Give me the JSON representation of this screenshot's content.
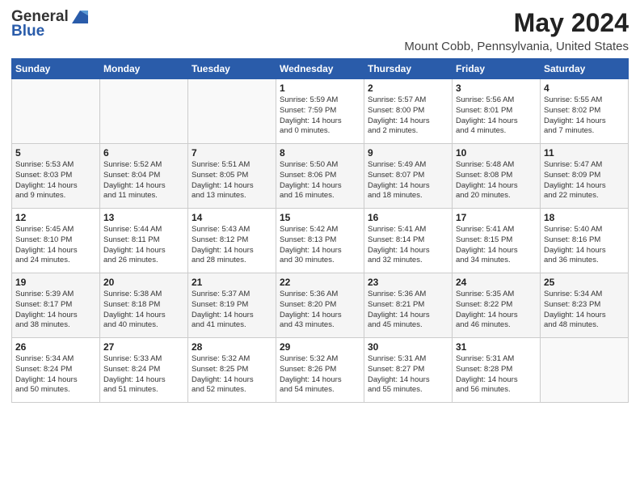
{
  "logo": {
    "general": "General",
    "blue": "Blue"
  },
  "title": "May 2024",
  "subtitle": "Mount Cobb, Pennsylvania, United States",
  "headers": [
    "Sunday",
    "Monday",
    "Tuesday",
    "Wednesday",
    "Thursday",
    "Friday",
    "Saturday"
  ],
  "weeks": [
    [
      {
        "day": "",
        "lines": []
      },
      {
        "day": "",
        "lines": []
      },
      {
        "day": "",
        "lines": []
      },
      {
        "day": "1",
        "lines": [
          "Sunrise: 5:59 AM",
          "Sunset: 7:59 PM",
          "Daylight: 14 hours",
          "and 0 minutes."
        ]
      },
      {
        "day": "2",
        "lines": [
          "Sunrise: 5:57 AM",
          "Sunset: 8:00 PM",
          "Daylight: 14 hours",
          "and 2 minutes."
        ]
      },
      {
        "day": "3",
        "lines": [
          "Sunrise: 5:56 AM",
          "Sunset: 8:01 PM",
          "Daylight: 14 hours",
          "and 4 minutes."
        ]
      },
      {
        "day": "4",
        "lines": [
          "Sunrise: 5:55 AM",
          "Sunset: 8:02 PM",
          "Daylight: 14 hours",
          "and 7 minutes."
        ]
      }
    ],
    [
      {
        "day": "5",
        "lines": [
          "Sunrise: 5:53 AM",
          "Sunset: 8:03 PM",
          "Daylight: 14 hours",
          "and 9 minutes."
        ]
      },
      {
        "day": "6",
        "lines": [
          "Sunrise: 5:52 AM",
          "Sunset: 8:04 PM",
          "Daylight: 14 hours",
          "and 11 minutes."
        ]
      },
      {
        "day": "7",
        "lines": [
          "Sunrise: 5:51 AM",
          "Sunset: 8:05 PM",
          "Daylight: 14 hours",
          "and 13 minutes."
        ]
      },
      {
        "day": "8",
        "lines": [
          "Sunrise: 5:50 AM",
          "Sunset: 8:06 PM",
          "Daylight: 14 hours",
          "and 16 minutes."
        ]
      },
      {
        "day": "9",
        "lines": [
          "Sunrise: 5:49 AM",
          "Sunset: 8:07 PM",
          "Daylight: 14 hours",
          "and 18 minutes."
        ]
      },
      {
        "day": "10",
        "lines": [
          "Sunrise: 5:48 AM",
          "Sunset: 8:08 PM",
          "Daylight: 14 hours",
          "and 20 minutes."
        ]
      },
      {
        "day": "11",
        "lines": [
          "Sunrise: 5:47 AM",
          "Sunset: 8:09 PM",
          "Daylight: 14 hours",
          "and 22 minutes."
        ]
      }
    ],
    [
      {
        "day": "12",
        "lines": [
          "Sunrise: 5:45 AM",
          "Sunset: 8:10 PM",
          "Daylight: 14 hours",
          "and 24 minutes."
        ]
      },
      {
        "day": "13",
        "lines": [
          "Sunrise: 5:44 AM",
          "Sunset: 8:11 PM",
          "Daylight: 14 hours",
          "and 26 minutes."
        ]
      },
      {
        "day": "14",
        "lines": [
          "Sunrise: 5:43 AM",
          "Sunset: 8:12 PM",
          "Daylight: 14 hours",
          "and 28 minutes."
        ]
      },
      {
        "day": "15",
        "lines": [
          "Sunrise: 5:42 AM",
          "Sunset: 8:13 PM",
          "Daylight: 14 hours",
          "and 30 minutes."
        ]
      },
      {
        "day": "16",
        "lines": [
          "Sunrise: 5:41 AM",
          "Sunset: 8:14 PM",
          "Daylight: 14 hours",
          "and 32 minutes."
        ]
      },
      {
        "day": "17",
        "lines": [
          "Sunrise: 5:41 AM",
          "Sunset: 8:15 PM",
          "Daylight: 14 hours",
          "and 34 minutes."
        ]
      },
      {
        "day": "18",
        "lines": [
          "Sunrise: 5:40 AM",
          "Sunset: 8:16 PM",
          "Daylight: 14 hours",
          "and 36 minutes."
        ]
      }
    ],
    [
      {
        "day": "19",
        "lines": [
          "Sunrise: 5:39 AM",
          "Sunset: 8:17 PM",
          "Daylight: 14 hours",
          "and 38 minutes."
        ]
      },
      {
        "day": "20",
        "lines": [
          "Sunrise: 5:38 AM",
          "Sunset: 8:18 PM",
          "Daylight: 14 hours",
          "and 40 minutes."
        ]
      },
      {
        "day": "21",
        "lines": [
          "Sunrise: 5:37 AM",
          "Sunset: 8:19 PM",
          "Daylight: 14 hours",
          "and 41 minutes."
        ]
      },
      {
        "day": "22",
        "lines": [
          "Sunrise: 5:36 AM",
          "Sunset: 8:20 PM",
          "Daylight: 14 hours",
          "and 43 minutes."
        ]
      },
      {
        "day": "23",
        "lines": [
          "Sunrise: 5:36 AM",
          "Sunset: 8:21 PM",
          "Daylight: 14 hours",
          "and 45 minutes."
        ]
      },
      {
        "day": "24",
        "lines": [
          "Sunrise: 5:35 AM",
          "Sunset: 8:22 PM",
          "Daylight: 14 hours",
          "and 46 minutes."
        ]
      },
      {
        "day": "25",
        "lines": [
          "Sunrise: 5:34 AM",
          "Sunset: 8:23 PM",
          "Daylight: 14 hours",
          "and 48 minutes."
        ]
      }
    ],
    [
      {
        "day": "26",
        "lines": [
          "Sunrise: 5:34 AM",
          "Sunset: 8:24 PM",
          "Daylight: 14 hours",
          "and 50 minutes."
        ]
      },
      {
        "day": "27",
        "lines": [
          "Sunrise: 5:33 AM",
          "Sunset: 8:24 PM",
          "Daylight: 14 hours",
          "and 51 minutes."
        ]
      },
      {
        "day": "28",
        "lines": [
          "Sunrise: 5:32 AM",
          "Sunset: 8:25 PM",
          "Daylight: 14 hours",
          "and 52 minutes."
        ]
      },
      {
        "day": "29",
        "lines": [
          "Sunrise: 5:32 AM",
          "Sunset: 8:26 PM",
          "Daylight: 14 hours",
          "and 54 minutes."
        ]
      },
      {
        "day": "30",
        "lines": [
          "Sunrise: 5:31 AM",
          "Sunset: 8:27 PM",
          "Daylight: 14 hours",
          "and 55 minutes."
        ]
      },
      {
        "day": "31",
        "lines": [
          "Sunrise: 5:31 AM",
          "Sunset: 8:28 PM",
          "Daylight: 14 hours",
          "and 56 minutes."
        ]
      },
      {
        "day": "",
        "lines": []
      }
    ]
  ]
}
